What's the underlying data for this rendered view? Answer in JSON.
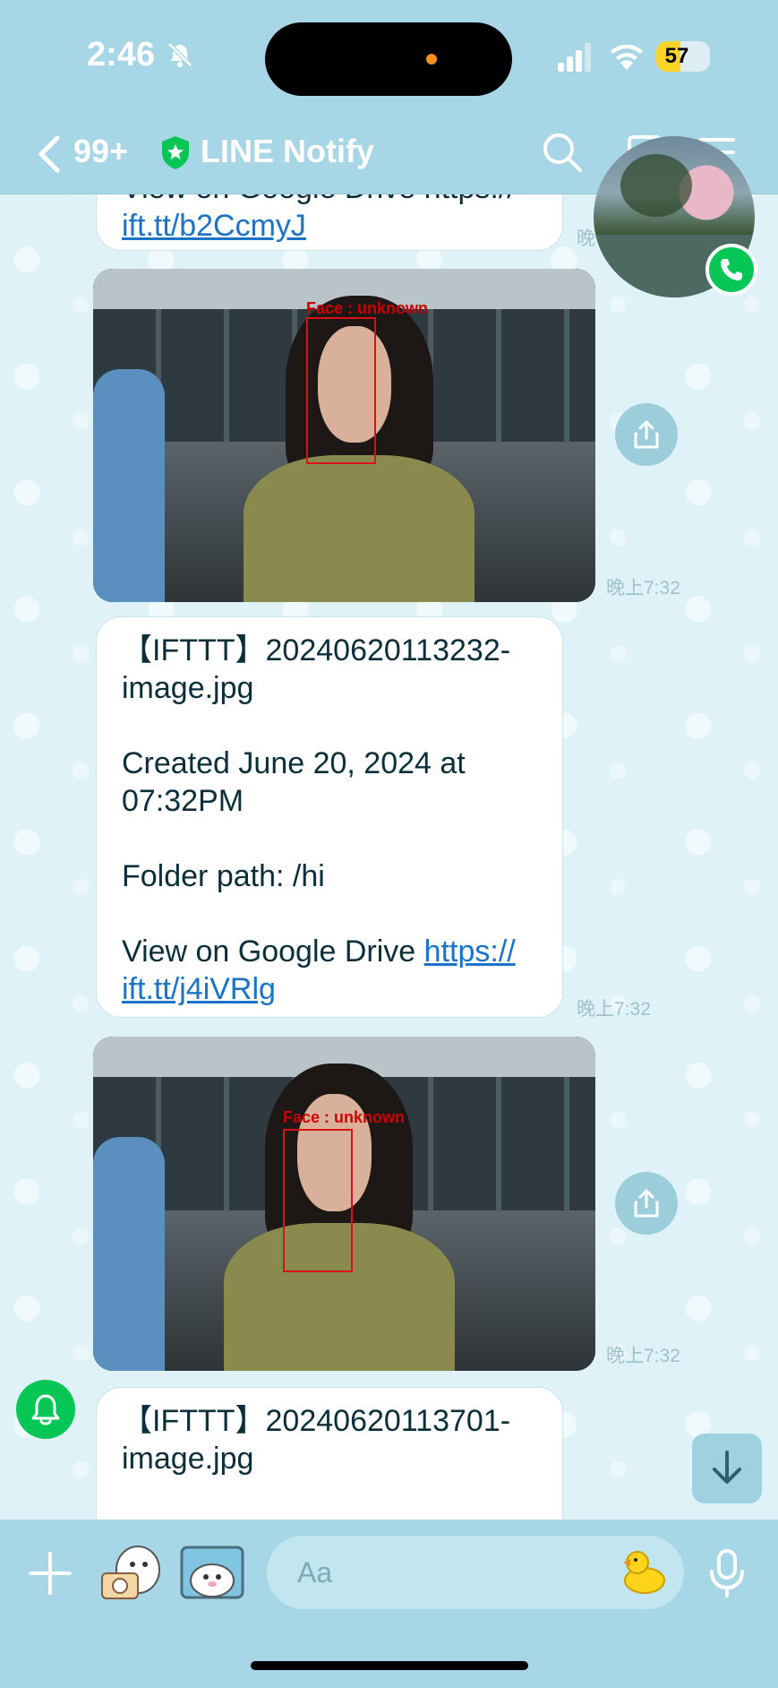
{
  "status_bar": {
    "time": "2:46",
    "battery_percent": "57",
    "battery_level": 0.57
  },
  "header": {
    "unread_count": "99+",
    "title": "LINE Notify"
  },
  "messages": [
    {
      "type": "text",
      "lines": [
        "View on Google Drive https://",
        "ift.tt/b2CcmyJ"
      ],
      "link_text": "ift.tt/b2CcmyJ",
      "time": "晚"
    },
    {
      "type": "image",
      "face_label": "Face : unknown",
      "time": "晚上7:32"
    },
    {
      "type": "text",
      "title_line1": "【IFTTT】20240620113232-",
      "title_line2": "image.jpg",
      "created_line1": "Created June 20, 2024 at",
      "created_line2": "07:32PM",
      "folder": "Folder path: /hi",
      "drive_prefix": "View on Google Drive ",
      "link_line1": "https://",
      "link_line2": "ift.tt/j4iVRlg",
      "time": "晚上7:32"
    },
    {
      "type": "image",
      "face_label": "Face : unknown",
      "time": "晚上7:32"
    },
    {
      "type": "text",
      "title_line1": "【IFTTT】20240620113701-",
      "title_line2": "image.jpg"
    }
  ],
  "input_bar": {
    "placeholder": "Aa"
  },
  "icons": {
    "back": "chevron-left-icon",
    "verified": "shield-star-icon",
    "search": "search-icon",
    "notes": "notes-icon",
    "menu": "menu-icon",
    "call": "phone-icon",
    "share": "share-icon",
    "bot": "bell-icon",
    "scroll": "arrow-down-icon",
    "plus": "plus-icon",
    "mic": "microphone-icon"
  },
  "colors": {
    "header_bg": "#a7d7e6",
    "chat_bg": "#def2f7",
    "link": "#1a73c9",
    "line_green": "#06c755"
  }
}
